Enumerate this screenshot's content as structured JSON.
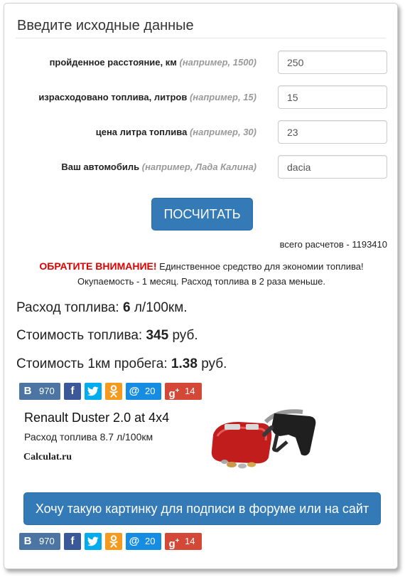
{
  "form": {
    "title": "Введите исходные данные",
    "fields": [
      {
        "label": "пройденное расстояние, км",
        "hint": "(например, 1500)",
        "value": "250"
      },
      {
        "label": "израсходовано топлива, литров",
        "hint": "(например, 15)",
        "value": "15"
      },
      {
        "label": "цена литра топлива",
        "hint": "(например, 30)",
        "value": "23"
      },
      {
        "label": "Ваш автомобиль",
        "hint": "(например, Лада Калина)",
        "value": "dacia"
      }
    ],
    "submit_label": "ПОСЧИТАТЬ",
    "total_calcs": "всего расчетов - 1193410"
  },
  "notice": {
    "warn": "ОБРАТИТЕ ВНИМАНИЕ!",
    "line1": "Единственное средство для экономии топлива!",
    "line2": "Окупаемость - 1 месяц. Расход топлива в 2 раза меньше."
  },
  "results": {
    "consumption_label": "Расход топлива:",
    "consumption_value": "6",
    "consumption_unit": "л/100км.",
    "cost_label": "Стоимость топлива:",
    "cost_value": "345",
    "cost_unit": "руб.",
    "km_cost_label": "Стоимость 1км пробега:",
    "km_cost_value": "1.38",
    "km_cost_unit": "руб."
  },
  "social": {
    "vk_count": "970",
    "mailru_count": "20",
    "gplus_count": "14",
    "colors": {
      "vk": "#4c75a3",
      "facebook": "#3b5998",
      "twitter": "#00aced",
      "ok": "#f59a1f",
      "mailru": "#168de2",
      "gplus": "#d34836"
    }
  },
  "card": {
    "car": "Renault Duster 2.0 at 4x4",
    "rate": "Расход топлива 8.7 л/100км",
    "site": "Calculat.ru"
  },
  "want_button_label": "Хочу такую картинку для подписи в форуме или на сайт",
  "colors": {
    "accent": "#337ab7",
    "warning": "#e00000"
  }
}
